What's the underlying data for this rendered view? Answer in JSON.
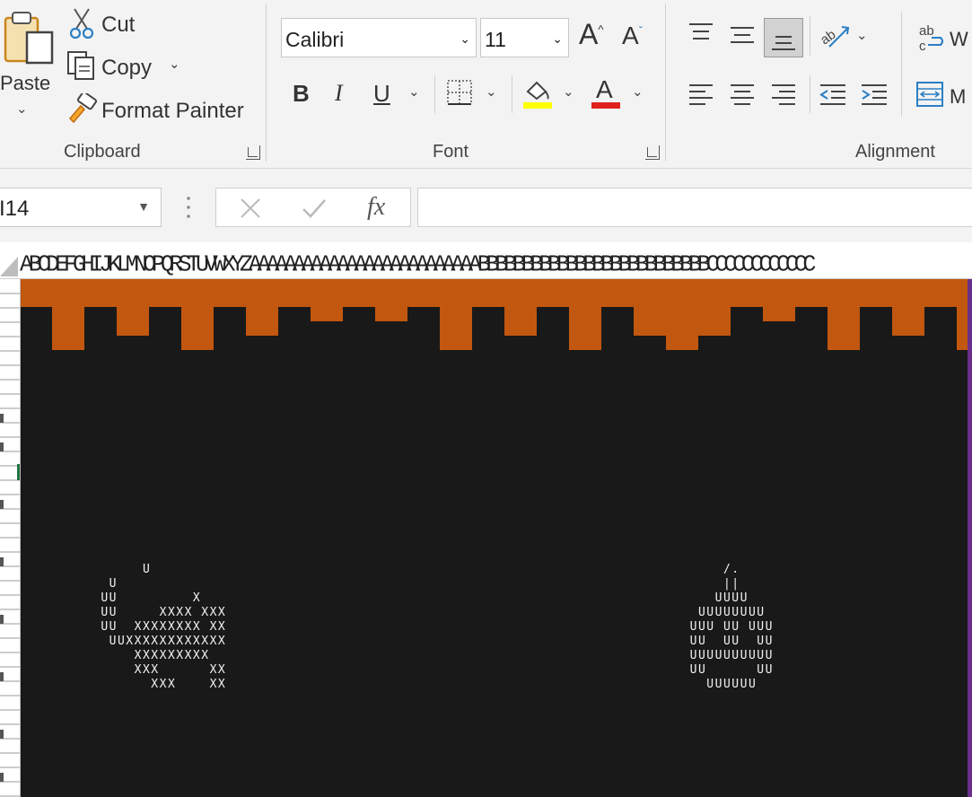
{
  "ribbon": {
    "clipboard": {
      "paste_label": "Paste",
      "cut_label": "Cut",
      "copy_label": "Copy",
      "format_painter_label": "Format Painter",
      "group_label": "Clipboard"
    },
    "font": {
      "font_name": "Calibri",
      "font_size": "11",
      "bold_label": "B",
      "italic_label": "I",
      "underline_label": "U",
      "font_color_letter": "A",
      "group_label": "Font",
      "highlight_color": "#ffff00",
      "font_color": "#e0201b"
    },
    "alignment": {
      "wrap_label": "W",
      "merge_label": "M",
      "group_label": "Alignment"
    }
  },
  "formula_bar": {
    "name_box": "I14",
    "fx_label": "fx",
    "value": ""
  },
  "sheet": {
    "column_header_text": "ABCDEFGHIJKLMNOPQRSTUVWXYZAAAAAAAAAAAAAAAAAAAAAAAAAABBBBBBBBBBBBBBBBBBBBBBBBBBCCCCCCCCCCCC",
    "colors": {
      "sky": "#c2570f",
      "ground": "#191919",
      "border_right": "#6a2f8a"
    }
  },
  "game": {
    "sprite_left": [
      "      U",
      "  U",
      " UU         X",
      " UU     XXXX XXX",
      " UU  XXXXXXXX XX",
      "  UUXXXXXXXXXXXX",
      "     XXXXXXXXX",
      "     XXX      XX",
      "       XXX    XX"
    ],
    "sprite_right": [
      "      /.",
      "      ||",
      "     UUUU",
      "   UUUUUUUU",
      "  UUU UU UUU",
      "  UU  UU  UU",
      "  UUUUUUUUUU",
      "  UU      UU",
      "    UUUUUU"
    ]
  }
}
